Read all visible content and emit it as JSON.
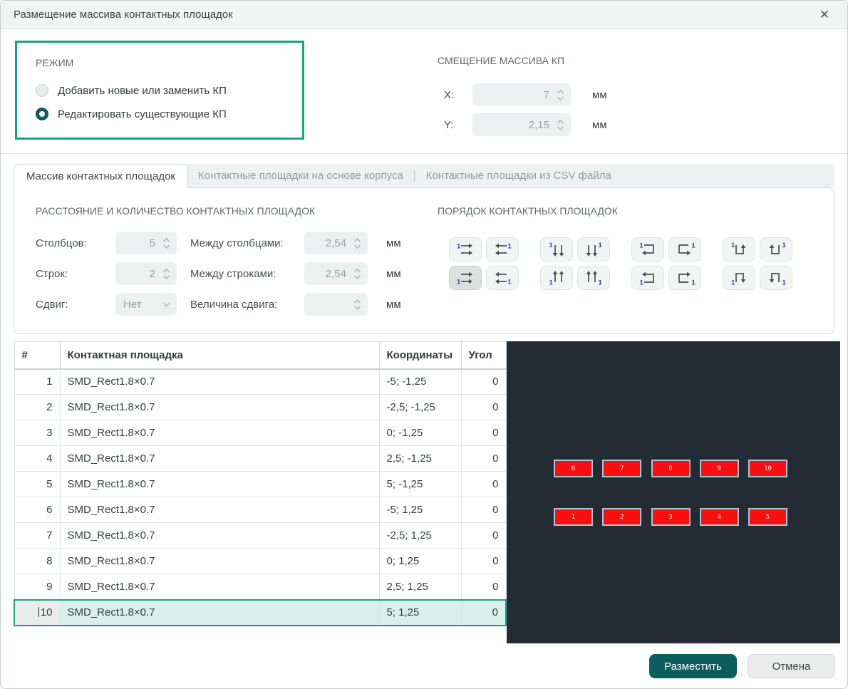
{
  "window": {
    "title": "Размещение массива контактных площадок",
    "close_icon": "✕"
  },
  "mode": {
    "section_label": "РЕЖИМ",
    "options": [
      {
        "label": "Добавить новые или заменить КП",
        "selected": false
      },
      {
        "label": "Редактировать существующие КП",
        "selected": true
      }
    ]
  },
  "offset": {
    "section_label": "СМЕЩЕНИЕ МАССИВА КП",
    "rows": [
      {
        "label": "X:",
        "value": "7",
        "unit": "мм"
      },
      {
        "label": "Y:",
        "value": "2,15",
        "unit": "мм"
      }
    ]
  },
  "tabs": [
    {
      "label": "Массив контактных площадок",
      "active": true
    },
    {
      "label": "Контактные площадки на основе корпуса",
      "active": false
    },
    {
      "label": "Контактные площадки из CSV файла",
      "active": false
    }
  ],
  "tab_separator": "|",
  "spacing": {
    "section_label": "РАССТОЯНИЕ И КОЛИЧЕСТВО КОНТАКТНЫХ ПЛОЩАДОК",
    "rows": [
      {
        "label1": "Столбцов:",
        "value1": "5",
        "label2": "Между столбцами:",
        "value2": "2,54",
        "unit": "мм"
      },
      {
        "label1": "Строк:",
        "value1": "2",
        "label2": "Между строками:",
        "value2": "2,54",
        "unit": "мм"
      },
      {
        "label1": "Сдвиг:",
        "value1": "Нет",
        "label2": "Величина сдвига:",
        "value2": "",
        "unit": "мм"
      }
    ]
  },
  "order": {
    "section_label": "ПОРЯДОК КОНТАКТНЫХ ПЛОЩАДОК",
    "selected": "rows-right-start-bottom",
    "groups": [
      [
        "rows-right-start-top",
        "rows-left-start-top",
        "rows-right-start-bottom",
        "rows-left-start-bottom"
      ],
      [
        "cols-down-start-left",
        "cols-down-start-right",
        "cols-up-start-left",
        "cols-up-start-right"
      ],
      [
        "snake-rows-start-top-left",
        "snake-rows-start-top-right",
        "snake-rows-start-bottom-left",
        "snake-rows-start-bottom-right"
      ],
      [
        "snake-cols-start-top-left",
        "snake-cols-start-top-right",
        "snake-cols-start-bottom-left",
        "snake-cols-start-bottom-right"
      ]
    ]
  },
  "table": {
    "columns": [
      "#",
      "Контактная площадка",
      "Координаты",
      "Угол"
    ],
    "selected_index": 9,
    "rows": [
      {
        "num": "1",
        "pad": "SMD_Rect1.8×0.7",
        "coords": "-5; -1,25",
        "angle": "0"
      },
      {
        "num": "2",
        "pad": "SMD_Rect1.8×0.7",
        "coords": "-2,5; -1,25",
        "angle": "0"
      },
      {
        "num": "3",
        "pad": "SMD_Rect1.8×0.7",
        "coords": "0; -1,25",
        "angle": "0"
      },
      {
        "num": "4",
        "pad": "SMD_Rect1.8×0.7",
        "coords": "2,5; -1,25",
        "angle": "0"
      },
      {
        "num": "5",
        "pad": "SMD_Rect1.8×0.7",
        "coords": "5; -1,25",
        "angle": "0"
      },
      {
        "num": "6",
        "pad": "SMD_Rect1.8×0.7",
        "coords": "-5; 1,25",
        "angle": "0"
      },
      {
        "num": "7",
        "pad": "SMD_Rect1.8×0.7",
        "coords": "-2,5; 1,25",
        "angle": "0"
      },
      {
        "num": "8",
        "pad": "SMD_Rect1.8×0.7",
        "coords": "0; 1,25",
        "angle": "0"
      },
      {
        "num": "9",
        "pad": "SMD_Rect1.8×0.7",
        "coords": "2,5; 1,25",
        "angle": "0"
      },
      {
        "num": "10",
        "pad": "SMD_Rect1.8×0.7",
        "coords": "5; 1,25",
        "angle": "0"
      }
    ]
  },
  "preview": {
    "background": "#242b34",
    "pad_color": "#f90f0f",
    "pad_border_color": "#a6c8d6",
    "rows": [
      {
        "pads": [
          "6",
          "7",
          "8",
          "9",
          "10"
        ]
      },
      {
        "pads": [
          "1",
          "2",
          "3",
          "4",
          "5"
        ]
      }
    ]
  },
  "footer": {
    "place_label": "Разместить",
    "cancel_label": "Отмена"
  },
  "colors": {
    "accent": "#0c5e5e",
    "mode_box_border": "#17a385",
    "selected_row_bg": "#d8efec",
    "selected_row_border": "#1a9e8e"
  }
}
